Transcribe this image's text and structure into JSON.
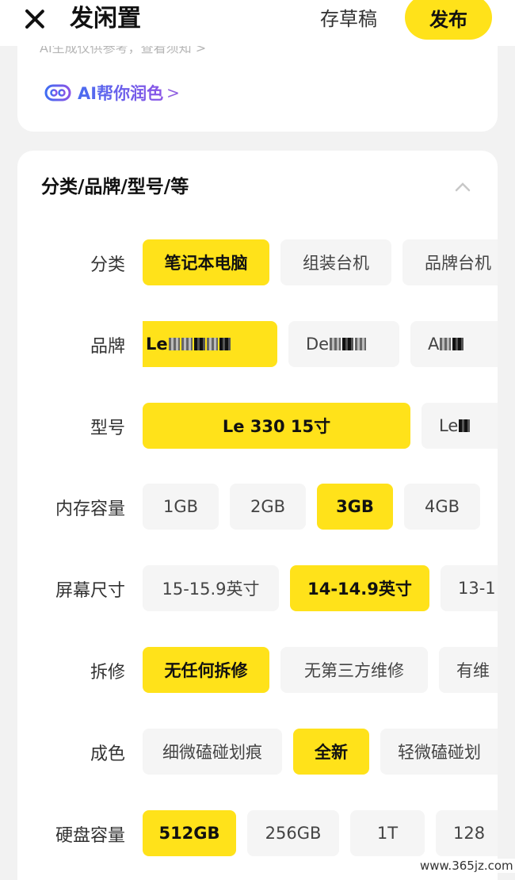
{
  "header": {
    "title": "发闲置",
    "draft_label": "存草稿",
    "publish_label": "发布"
  },
  "ai": {
    "hint": "AI生成仅供参考，查看须知 >",
    "polish_label": "AI帮你润色",
    "polish_chevron": ">"
  },
  "attributes": {
    "section_title": "分类/品牌/型号/等",
    "rows": [
      {
        "label": "分类",
        "options": [
          "笔记本电脑",
          "组装台机",
          "品牌台机"
        ],
        "selected": "笔记本电脑"
      },
      {
        "label": "品牌",
        "options": [
          "Le",
          "De",
          "A"
        ],
        "selected": "Le"
      },
      {
        "label": "型号",
        "options": [
          "Le  330 15寸",
          "Le"
        ],
        "selected": "Le  330 15寸"
      },
      {
        "label": "内存容量",
        "options": [
          "1GB",
          "2GB",
          "3GB",
          "4GB"
        ],
        "selected": "3GB"
      },
      {
        "label": "屏幕尺寸",
        "options": [
          "15-15.9英寸",
          "14-14.9英寸",
          "13-1"
        ],
        "selected": "14-14.9英寸"
      },
      {
        "label": "拆修",
        "options": [
          "无任何拆修",
          "无第三方维修",
          "有维"
        ],
        "selected": "无任何拆修"
      },
      {
        "label": "成色",
        "options": [
          "细微磕碰划痕",
          "全新",
          "轻微磕碰划"
        ],
        "selected": "全新"
      },
      {
        "label": "硬盘容量",
        "options": [
          "512GB",
          "256GB",
          "1T",
          "128"
        ],
        "selected": "512GB"
      }
    ]
  },
  "watermark": "www.365jz.com",
  "colors": {
    "accent": "#ffe21a",
    "chip_bg": "#f5f5f5",
    "page_bg": "#f2f2f2"
  }
}
